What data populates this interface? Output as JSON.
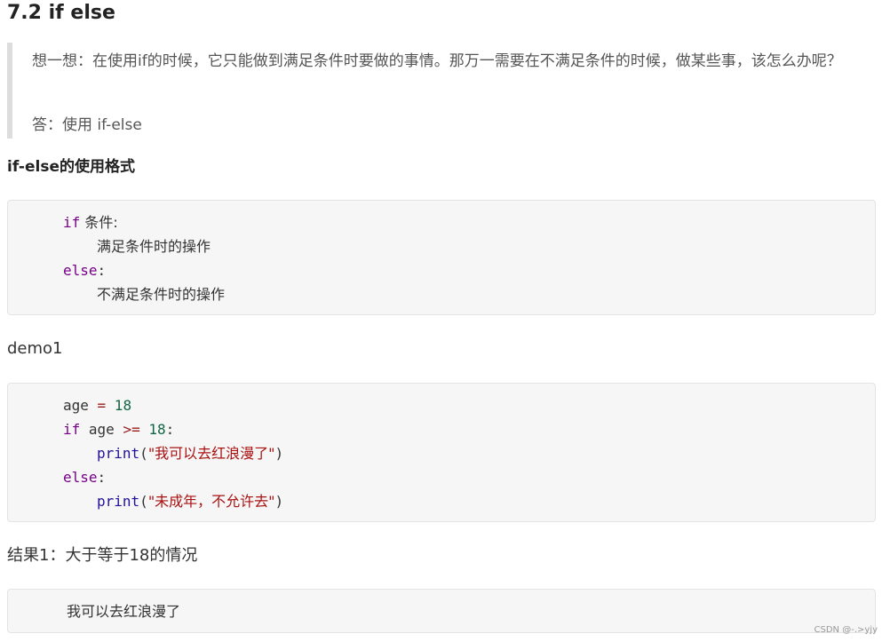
{
  "heading": "7.2 if else",
  "quote": {
    "line1": "想一想：在使用if的时候，它只能做到满足条件时要做的事情。那万一需要在不满足条件的时候，做某些事，该怎么办呢？",
    "answer": "答：使用 if-else"
  },
  "subheading": "if-else的使用格式",
  "format_block": {
    "if_kw": "if",
    "if_cond": " 条件:",
    "body1": "满足条件时的操作",
    "else_kw": "else",
    "else_colon": ":",
    "body2": "不满足条件时的操作"
  },
  "demo_label": "demo1",
  "demo_block": {
    "l1_var": "age ",
    "l1_op": "=",
    "l1_num": " 18",
    "l2_if": "if",
    "l2_var": " age ",
    "l2_op": ">=",
    "l2_num": " 18",
    "l2_colon": ":",
    "l3_fn": "print",
    "l3_open": "(",
    "l3_str": "\"我可以去红浪漫了\"",
    "l3_close": ")",
    "l4_else": "else",
    "l4_colon": ":",
    "l5_fn": "print",
    "l5_open": "(",
    "l5_str": "\"未成年，不允许去\"",
    "l5_close": ")"
  },
  "result_label": "结果1：大于等于18的情况",
  "result_block": {
    "output": "我可以去红浪漫了"
  },
  "watermark": "CSDN @-.>yjy"
}
